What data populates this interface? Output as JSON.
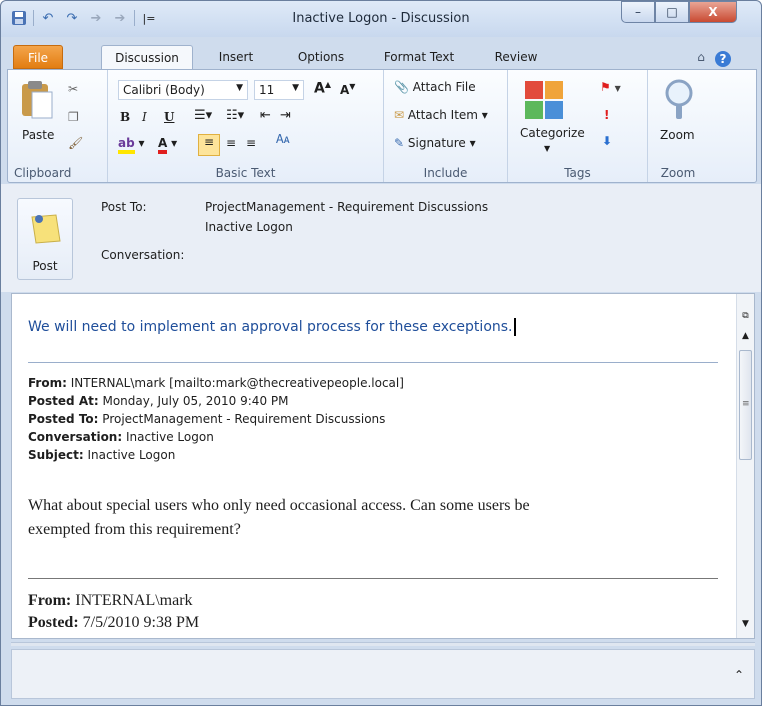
{
  "window": {
    "title": "Inactive Logon - Discussion",
    "controls": {
      "minimize": "–",
      "maximize": "□",
      "close": "X"
    }
  },
  "quick_access": {
    "save_icon": "save-icon",
    "undo_icon": "undo-icon",
    "redo_icon": "redo-icon",
    "up_icon": "up-icon",
    "down_icon": "down-icon",
    "customize": "|="
  },
  "tabs": [
    {
      "label": "File"
    },
    {
      "label": "Discussion"
    },
    {
      "label": "Insert"
    },
    {
      "label": "Options"
    },
    {
      "label": "Format Text"
    },
    {
      "label": "Review"
    }
  ],
  "ribbon": {
    "clipboard": {
      "paste": "Paste",
      "group": "Clipboard"
    },
    "basic_text": {
      "font": "Calibri (Body)",
      "size": "11",
      "bold": "B",
      "italic": "I",
      "underline": "U",
      "group": "Basic Text"
    },
    "include": {
      "attach_file": "Attach File",
      "attach_item": "Attach Item",
      "signature": "Signature",
      "group": "Include"
    },
    "tags": {
      "categorize": "Categorize",
      "group": "Tags"
    },
    "zoom": {
      "zoom": "Zoom",
      "group": "Zoom"
    }
  },
  "header": {
    "post_button": "Post",
    "post_to_label": "Post To:",
    "post_to_value": "ProjectManagement - Requirement Discussions",
    "conversation_value": "Inactive Logon",
    "conversation_label": "Conversation:"
  },
  "message": {
    "typed_text": "We will need to implement an approval process for these exceptions.",
    "quote1": {
      "from_label": "From:",
      "from_value": "INTERNAL\\mark [mailto:mark@thecreativepeople.local]",
      "posted_at_label": "Posted At:",
      "posted_at_value": "Monday, July 05, 2010 9:40 PM",
      "posted_to_label": "Posted To:",
      "posted_to_value": "ProjectManagement - Requirement Discussions",
      "conversation_label": "Conversation:",
      "conversation_value": "Inactive Logon",
      "subject_label": "Subject:",
      "subject_value": "Inactive Logon",
      "body_line1": "What about special users who only need occasional access. Can some users be",
      "body_line2": "exempted from this requirement?"
    },
    "quote2": {
      "from_label": "From:",
      "from_value": "INTERNAL\\mark",
      "posted_label": "Posted:",
      "posted_value": "7/5/2010 9:38 PM"
    }
  },
  "colors": {
    "typed_text": "#1f4e9a",
    "file_tab": "#e27d12"
  }
}
